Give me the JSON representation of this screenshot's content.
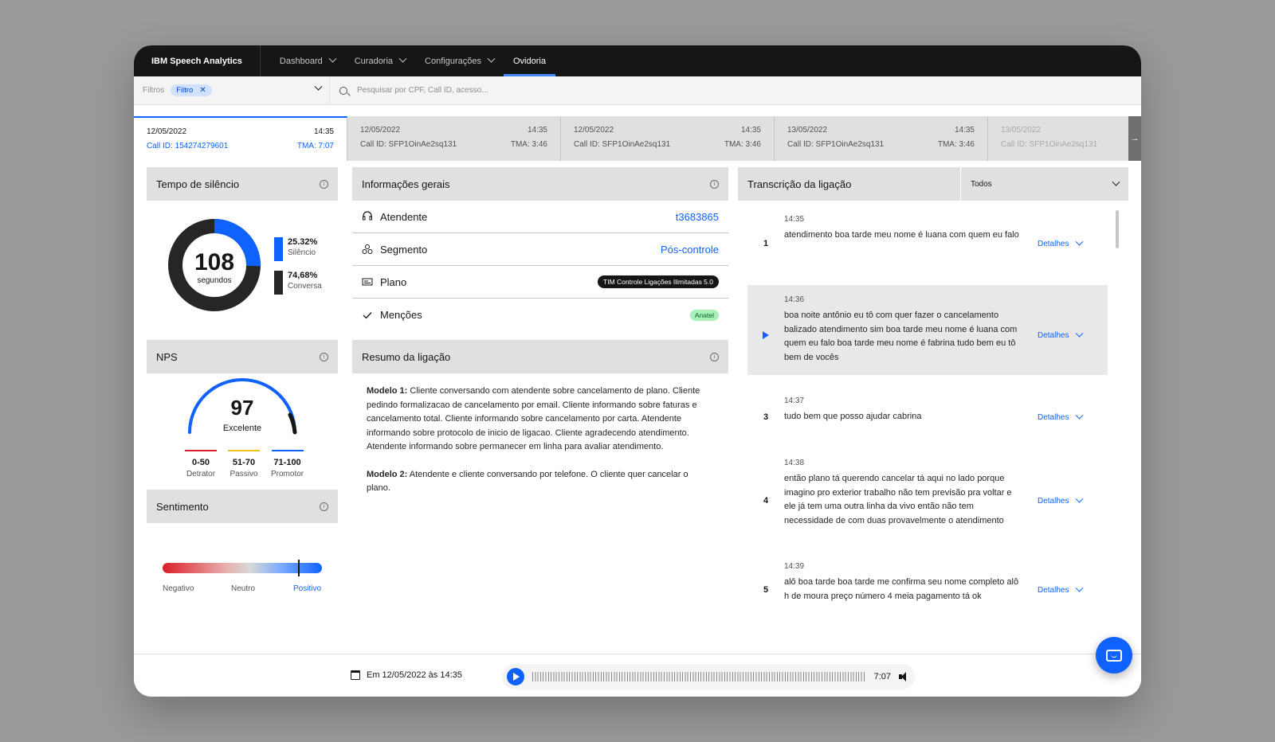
{
  "nav": {
    "brand": "IBM Speech Analytics",
    "items": [
      {
        "label": "Dashboard"
      },
      {
        "label": "Curadoria"
      },
      {
        "label": "Configurações"
      },
      {
        "label": "Ovidoria"
      }
    ]
  },
  "filters": {
    "label": "Filtros",
    "tag": "Filtro",
    "search_placeholder": "Pesquisar por CPF, Call ID, acesso..."
  },
  "calls": [
    {
      "date": "12/05/2022",
      "time": "14:35",
      "call_id": "Call ID: 154274279601",
      "tma": "TMA: 7:07"
    },
    {
      "date": "12/05/2022",
      "time": "14:35",
      "call_id": "Call ID: SFP1OinAe2sq131",
      "tma": "TMA: 3:46"
    },
    {
      "date": "12/05/2022",
      "time": "14:35",
      "call_id": "Call ID: SFP1OinAe2sq131",
      "tma": "TMA: 3:46"
    },
    {
      "date": "13/05/2022",
      "time": "14:35",
      "call_id": "Call ID: SFP1OinAe2sq131",
      "tma": "TMA: 3:46"
    },
    {
      "date": "13/05/2022",
      "time": "",
      "call_id": "Call ID: SFP1OinAe2sq131",
      "tma": ""
    }
  ],
  "silence": {
    "title": "Tempo de silêncio",
    "value": "108",
    "unit": "segundos",
    "silence_fraction": 0.2532,
    "silence_pct": "25.32%",
    "silence_label": "Silêncio",
    "talk_pct": "74,68%",
    "talk_label": "Conversa",
    "colors": {
      "silence": "#0f62fe",
      "talk": "#262626"
    }
  },
  "nps": {
    "title": "NPS",
    "value": "97",
    "label": "Excelente",
    "ranges": [
      {
        "range": "0-50",
        "label": "Detrator",
        "color": "#da1e28"
      },
      {
        "range": "51-70",
        "label": "Passivo",
        "color": "#f1c21b"
      },
      {
        "range": "71-100",
        "label": "Promotor",
        "color": "#0f62fe"
      }
    ]
  },
  "sentiment": {
    "title": "Sentimento",
    "marker_fraction": 0.85,
    "negative": "Negativo",
    "neutral": "Neutro",
    "positive": "Positivo"
  },
  "info": {
    "title": "Informações gerais",
    "rows": [
      {
        "label": "Atendente",
        "value": "t3683865"
      },
      {
        "label": "Segmento",
        "value": "Pós-controle"
      },
      {
        "label": "Plano",
        "value": "TIM Controle Ligações Ilimitadas 5.0"
      },
      {
        "label": "Menções",
        "value": "Anatel"
      }
    ]
  },
  "summary": {
    "title": "Resumo da ligação",
    "m1_label": "Modelo 1:",
    "m1_text": " Cliente conversando com atendente sobre cancelamento de plano. Cliente pedindo formalizacao de cancelamento por email. Cliente informando sobre faturas e cancelamento total. Cliente informando sobre cancelamento por carta. Atendente informando sobre protocolo de inicio de ligacao. Cliente agradecendo atendimento. Atendente informando sobre permanecer em linha para avaliar atendimento.",
    "m2_label": "Modelo 2:",
    "m2_text": " Atendente e cliente conversando por telefone. O cliente quer cancelar o plano."
  },
  "transcript": {
    "title": "Transcrição da ligação",
    "filter": "Todos",
    "details_label": "Detalhes",
    "items": [
      {
        "num": "1",
        "time": "14:35",
        "text": "atendimento boa tarde meu nome é luana com quem eu falo"
      },
      {
        "num": "",
        "time": "14:36",
        "text": "boa noite antônio eu tô com quer fazer o cancelamento balizado atendimento sim boa tarde meu nome é luana com quem eu falo boa tarde meu nome é fabrina tudo bem eu tô bem de vocês"
      },
      {
        "num": "3",
        "time": "14:37",
        "text": "tudo bem que posso ajudar cabrina"
      },
      {
        "num": "4",
        "time": "14:38",
        "text": "então plano tá querendo cancelar tá aqui no lado porque imagino pro exterior trabalho não tem previsão pra voltar e ele já tem uma outra linha da vivo então não tem necessidade de com duas provavelmente o atendimento"
      },
      {
        "num": "5",
        "time": "14:39",
        "text": "alô boa tarde boa tarde me confirma seu nome completo alô h de moura preço número 4 meia pagamento tá ok"
      }
    ]
  },
  "player": {
    "date": "Em 12/05/2022 às 14:35",
    "duration": "7:07"
  }
}
